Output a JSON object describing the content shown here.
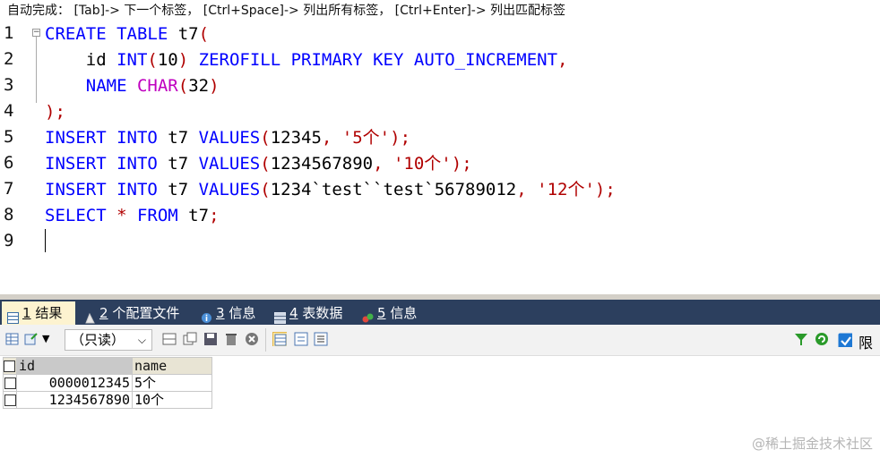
{
  "hint": "自动完成： [Tab]-> 下一个标签， [Ctrl+Space]-> 列出所有标签， [Ctrl+Enter]-> 列出匹配标签",
  "editor": {
    "line_numbers": [
      "1",
      "2",
      "3",
      "4",
      "5",
      "6",
      "7",
      "8",
      "9"
    ],
    "lines": [
      [
        {
          "t": "CREATE",
          "c": "kw"
        },
        {
          "t": " ",
          "c": "id"
        },
        {
          "t": "TABLE",
          "c": "kw"
        },
        {
          "t": " t7",
          "c": "id"
        },
        {
          "t": "(",
          "c": "op"
        }
      ],
      [
        {
          "t": "    id ",
          "c": "id"
        },
        {
          "t": "INT",
          "c": "kw"
        },
        {
          "t": "(",
          "c": "op"
        },
        {
          "t": "10",
          "c": "num"
        },
        {
          "t": ")",
          "c": "op"
        },
        {
          "t": " ",
          "c": "id"
        },
        {
          "t": "ZEROFILL PRIMARY KEY AUTO_INCREMENT",
          "c": "kw"
        },
        {
          "t": ",",
          "c": "op"
        }
      ],
      [
        {
          "t": "    ",
          "c": "id"
        },
        {
          "t": "NAME",
          "c": "kw"
        },
        {
          "t": " ",
          "c": "id"
        },
        {
          "t": "CHAR",
          "c": "ty"
        },
        {
          "t": "(",
          "c": "op"
        },
        {
          "t": "32",
          "c": "num"
        },
        {
          "t": ")",
          "c": "op"
        }
      ],
      [
        {
          "t": ");",
          "c": "op"
        }
      ],
      [
        {
          "t": "INSERT INTO",
          "c": "kw"
        },
        {
          "t": " t7 ",
          "c": "id"
        },
        {
          "t": "VALUES",
          "c": "kw"
        },
        {
          "t": "(",
          "c": "op"
        },
        {
          "t": "12345",
          "c": "num"
        },
        {
          "t": ", ",
          "c": "op"
        },
        {
          "t": "'5个'",
          "c": "str"
        },
        {
          "t": ");",
          "c": "op"
        }
      ],
      [
        {
          "t": "INSERT INTO",
          "c": "kw"
        },
        {
          "t": " t7 ",
          "c": "id"
        },
        {
          "t": "VALUES",
          "c": "kw"
        },
        {
          "t": "(",
          "c": "op"
        },
        {
          "t": "1234567890",
          "c": "num"
        },
        {
          "t": ", ",
          "c": "op"
        },
        {
          "t": "'10个'",
          "c": "str"
        },
        {
          "t": ");",
          "c": "op"
        }
      ],
      [
        {
          "t": "INSERT INTO",
          "c": "kw"
        },
        {
          "t": " t7 ",
          "c": "id"
        },
        {
          "t": "VALUES",
          "c": "kw"
        },
        {
          "t": "(",
          "c": "op"
        },
        {
          "t": "1234`test``test`56789012",
          "c": "num"
        },
        {
          "t": ", ",
          "c": "op"
        },
        {
          "t": "'12个'",
          "c": "str"
        },
        {
          "t": ");",
          "c": "op"
        }
      ],
      [
        {
          "t": "SELECT",
          "c": "kw"
        },
        {
          "t": " * ",
          "c": "op"
        },
        {
          "t": "FROM",
          "c": "kw"
        },
        {
          "t": " t7",
          "c": "id"
        },
        {
          "t": ";",
          "c": "op"
        }
      ],
      []
    ]
  },
  "tabs": [
    {
      "num": "1",
      "label": " 结果",
      "active": true
    },
    {
      "num": "2",
      "label": " 个配置文件",
      "active": false
    },
    {
      "num": "3",
      "label": " 信息",
      "active": false
    },
    {
      "num": "4",
      "label": " 表数据",
      "active": false
    },
    {
      "num": "5",
      "label": " 信息",
      "active": false
    }
  ],
  "toolbar": {
    "mode_select": "（只读）",
    "limit_label": "限"
  },
  "grid": {
    "columns": [
      "id",
      "name"
    ],
    "rows": [
      [
        "0000012345",
        "5个"
      ],
      [
        "1234567890",
        "10个"
      ]
    ]
  },
  "watermark": "@稀土掘金技术社区",
  "colors": {
    "tabbar": "#2c3f5e",
    "active_tab": "#fdf3d0",
    "keyword": "#0000ff",
    "string": "#b00000",
    "type": "#c000c0"
  }
}
